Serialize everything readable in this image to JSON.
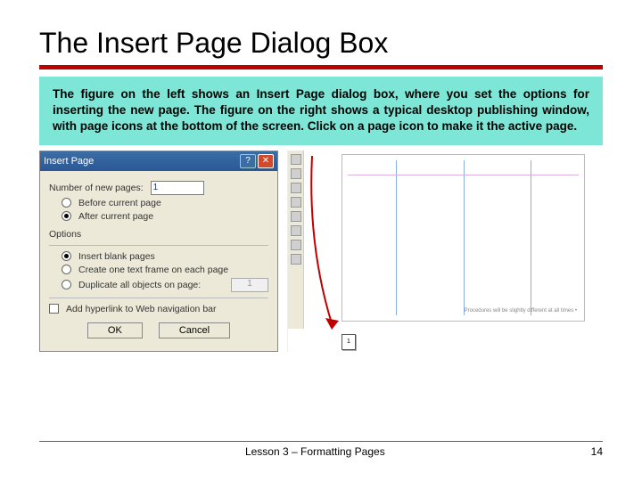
{
  "slide": {
    "title": "The Insert Page Dialog Box",
    "description": "The figure on the left shows an Insert Page dialog box, where you set the options for inserting the new page. The figure on the right shows a typical desktop publishing window, with page icons at the bottom of the screen. Click on a page icon to make it the active page."
  },
  "dialog": {
    "title": "Insert Page",
    "num_pages_label": "Number of new pages:",
    "num_pages_value": "1",
    "before_label": "Before current page",
    "after_label": "After current page",
    "options_heading": "Options",
    "blank_label": "Insert blank pages",
    "textframe_label": "Create one text frame on each page",
    "duplicate_label": "Duplicate all objects on page:",
    "duplicate_value": "1",
    "hyperlink_label": "Add hyperlink to Web navigation bar",
    "ok": "OK",
    "cancel": "Cancel"
  },
  "pubwin": {
    "note": "Procedures will be slightly different at all times •",
    "page_num": "1"
  },
  "footer": {
    "lesson": "Lesson 3 – Formatting Pages",
    "page": "14"
  }
}
